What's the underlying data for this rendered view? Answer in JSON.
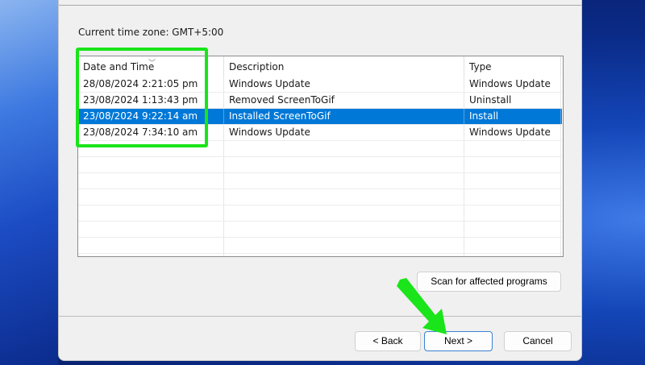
{
  "timezone_label": "Current time zone: GMT+5:00",
  "columns": [
    "Date and Time",
    "Description",
    "Type"
  ],
  "rows": [
    {
      "date": "28/08/2024 2:21:05 pm",
      "description": "Windows Update",
      "type": "Windows Update",
      "selected": false
    },
    {
      "date": "23/08/2024 1:13:43 pm",
      "description": "Removed ScreenToGif",
      "type": "Uninstall",
      "selected": false
    },
    {
      "date": "23/08/2024 9:22:14 am",
      "description": "Installed ScreenToGif",
      "type": "Install",
      "selected": true
    },
    {
      "date": "23/08/2024 7:34:10 am",
      "description": "Windows Update",
      "type": "Windows Update",
      "selected": false
    }
  ],
  "buttons": {
    "scan": "Scan for affected programs",
    "back": "< Back",
    "next": "Next >",
    "cancel": "Cancel"
  },
  "colors": {
    "selection": "#0078d7",
    "highlight": "#1ae41a"
  }
}
